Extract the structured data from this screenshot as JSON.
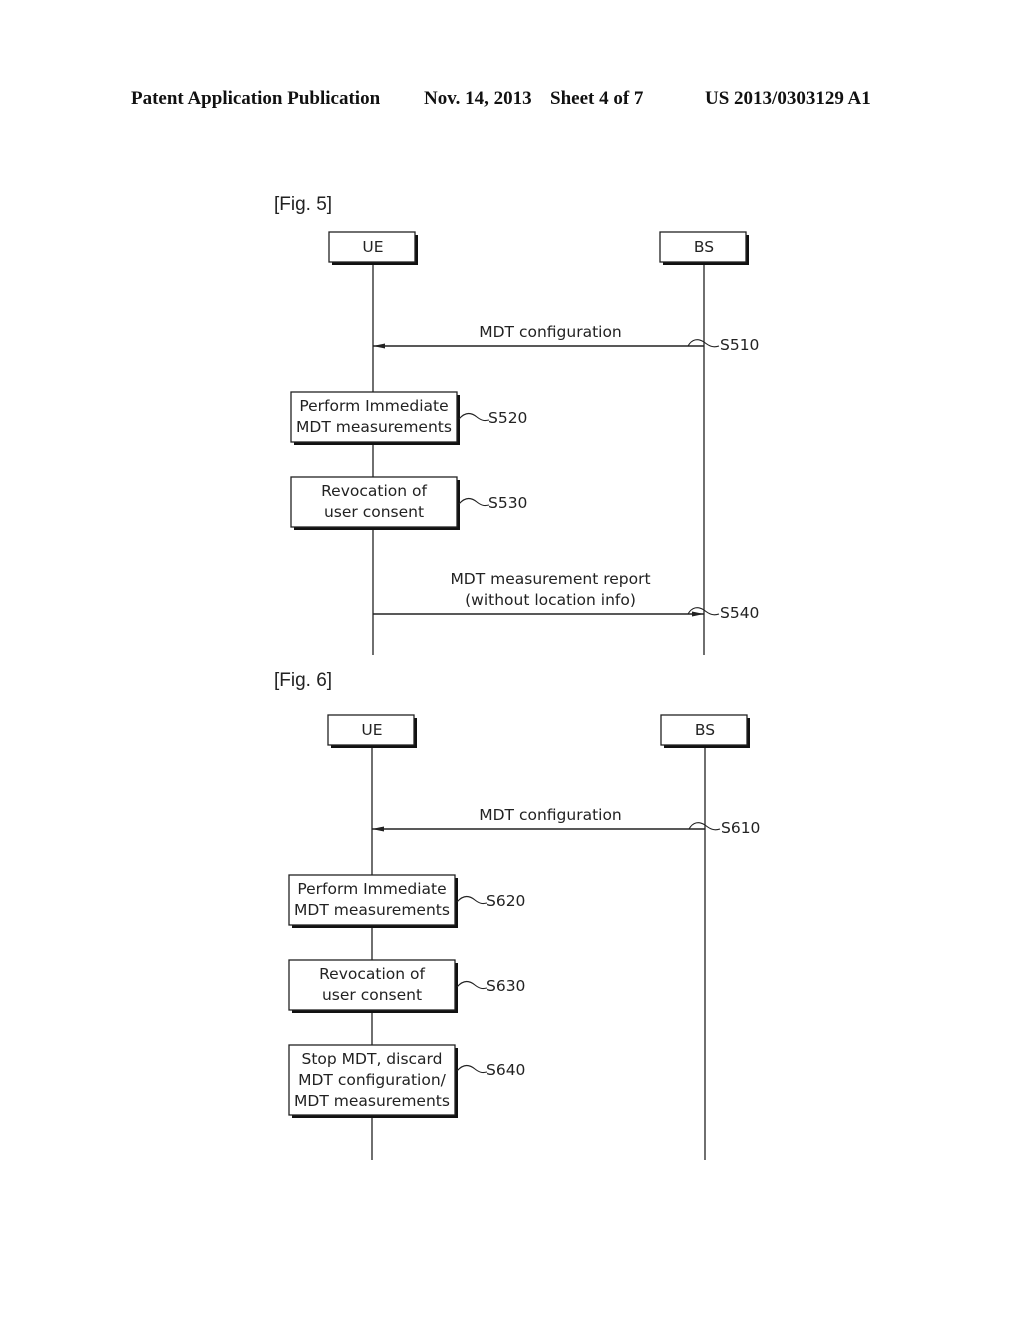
{
  "header": {
    "publication": "Patent Application Publication",
    "date": "Nov. 14, 2013",
    "sheet": "Sheet 4 of 7",
    "number": "US 2013/0303129 A1"
  },
  "figures": [
    {
      "id": "fig5",
      "label": "[Fig. 5]",
      "participants": [
        {
          "name": "UE"
        },
        {
          "name": "BS"
        }
      ],
      "steps": [
        {
          "type": "message",
          "from": "BS",
          "to": "UE",
          "lines": [
            "MDT configuration"
          ],
          "ref": "S510"
        },
        {
          "type": "action",
          "actor": "UE",
          "lines": [
            "Perform Immediate",
            "MDT measurements"
          ],
          "ref": "S520"
        },
        {
          "type": "action",
          "actor": "UE",
          "lines": [
            "Revocation of",
            "user consent"
          ],
          "ref": "S530"
        },
        {
          "type": "message",
          "from": "UE",
          "to": "BS",
          "lines": [
            "MDT measurement report",
            "(without location info)"
          ],
          "ref": "S540"
        }
      ]
    },
    {
      "id": "fig6",
      "label": "[Fig. 6]",
      "participants": [
        {
          "name": "UE"
        },
        {
          "name": "BS"
        }
      ],
      "steps": [
        {
          "type": "message",
          "from": "BS",
          "to": "UE",
          "lines": [
            "MDT configuration"
          ],
          "ref": "S610"
        },
        {
          "type": "action",
          "actor": "UE",
          "lines": [
            "Perform Immediate",
            "MDT measurements"
          ],
          "ref": "S620"
        },
        {
          "type": "action",
          "actor": "UE",
          "lines": [
            "Revocation of",
            "user consent"
          ],
          "ref": "S630"
        },
        {
          "type": "action",
          "actor": "UE",
          "lines": [
            "Stop MDT, discard",
            "MDT configuration/",
            "MDT measurements"
          ],
          "ref": "S640"
        }
      ]
    }
  ],
  "colors": {
    "ink": "#222222",
    "shadow": "#111111"
  }
}
